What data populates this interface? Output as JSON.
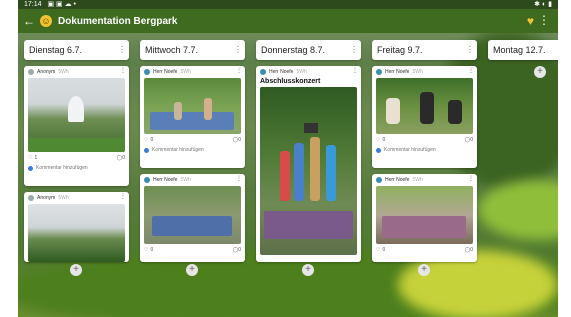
{
  "status": {
    "time": "17:14",
    "icons_left": "▣ ▣ ☁ •",
    "icons_right": "✱ ◐ ▮"
  },
  "appbar": {
    "back_icon": "←",
    "emoji": "☺",
    "title": "Dokumentation Bergpark",
    "heart_icon": "♥",
    "more_icon": "⋮"
  },
  "columns": [
    {
      "title": "Dienstag 6.7."
    },
    {
      "title": "Mittwoch 7.7."
    },
    {
      "title": "Donnerstag 8.7."
    },
    {
      "title": "Freitag 9.7."
    },
    {
      "title": "Montag 12.7."
    }
  ],
  "cards": {
    "c0a": {
      "author": "Anonym",
      "ago": "5Wh",
      "likes": "1",
      "comments": "0",
      "comment_placeholder": "Kommentar hinzufügen"
    },
    "c0b": {
      "author": "Anonym",
      "ago": "5Wh"
    },
    "c1a": {
      "author": "Herr Noefe",
      "ago": "5Wh",
      "likes": "0",
      "comments": "0",
      "comment_placeholder": "Kommentar hinzufügen"
    },
    "c1b": {
      "author": "Herr Noefe",
      "ago": "5Wh",
      "likes": "0",
      "comments": "0"
    },
    "c2a": {
      "author": "Herr Noefe",
      "ago": "5Wh",
      "title": "Abschlusskonzert"
    },
    "c3a": {
      "author": "Herr Noefe",
      "ago": "5Wh",
      "likes": "0",
      "comments": "0",
      "comment_placeholder": "Kommentar hinzufügen"
    },
    "c3b": {
      "author": "Herr Noefe",
      "ago": "5Wh",
      "likes": "0",
      "comments": "0"
    }
  },
  "icons": {
    "heart": "♡",
    "comment": "◯",
    "dots": "⋮",
    "plus": "+"
  }
}
